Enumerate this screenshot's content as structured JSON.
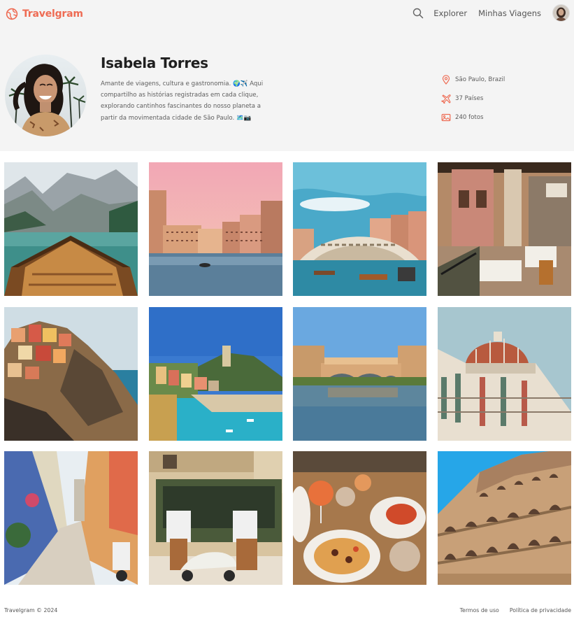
{
  "header": {
    "brand": "Travelgram",
    "nav": [
      "Explorer",
      "Minhas Viagens"
    ],
    "icons": [
      "globe-icon",
      "search-icon",
      "user-avatar"
    ]
  },
  "profile": {
    "name": "Isabela Torres",
    "bio": "Amante de viagens, cultura e gastronomia. 🌍✈️ Aqui compartilho as histórias registradas em cada clique, explorando cantinhos fascinantes do nosso planeta a partir da movimentada cidade de São Paulo. 🗺️📷",
    "stats": {
      "location": "São Paulo, Brazil",
      "countries": "37 Países",
      "photos": "240 fotos"
    }
  },
  "photos": [
    "lake-boat-mountains",
    "venice-canal-sunset",
    "rialto-bridge",
    "venice-cafe-street",
    "cinque-terre-cliff",
    "vernazza-harbor",
    "ponte-vecchio",
    "florence-duomo",
    "alley-scooter",
    "cafe-scooter",
    "italian-dinner-table",
    "colosseum"
  ],
  "footer": {
    "copyright": "Travelgram © 2024",
    "terms": "Termos de uso",
    "privacy": "Política de privacidade"
  },
  "colors": {
    "brand": "#ee6b53",
    "band": "#f4f4f4"
  }
}
